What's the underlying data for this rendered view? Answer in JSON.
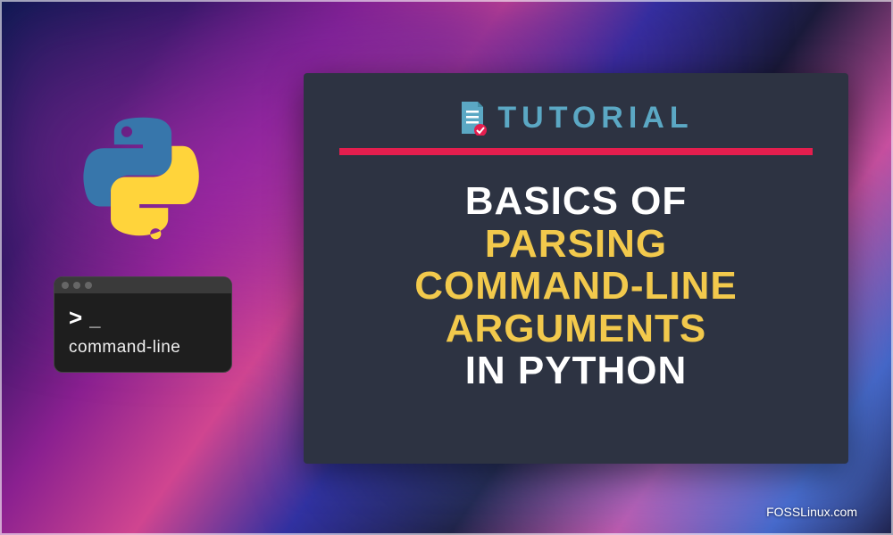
{
  "card": {
    "badge": "TUTORIAL",
    "title_line1": "BASICS OF",
    "title_line2": "PARSING",
    "title_line3": "COMMAND-LINE",
    "title_line4": "ARGUMENTS",
    "title_line5": "IN PYTHON"
  },
  "terminal": {
    "prompt_chevron": ">",
    "prompt_cursor": "_",
    "label": "command-line"
  },
  "watermark": "FOSSLinux.com"
}
